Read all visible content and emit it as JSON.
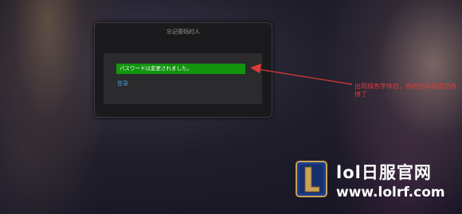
{
  "dialog": {
    "title": "忘记密码的人",
    "success_message": "パスワードは変更されました。",
    "login_link": "登录"
  },
  "annotation": {
    "text": "出现绿色字体后，你的密码就成功改掉了"
  },
  "watermark": {
    "site_name": "lol日服官网",
    "site_url": "www.lolrf.com",
    "logo_icon": "lol-logo-icon"
  },
  "colors": {
    "success_green": "#12940f",
    "link_blue": "#3a9ad9",
    "annotation_red": "#e23a3a"
  }
}
